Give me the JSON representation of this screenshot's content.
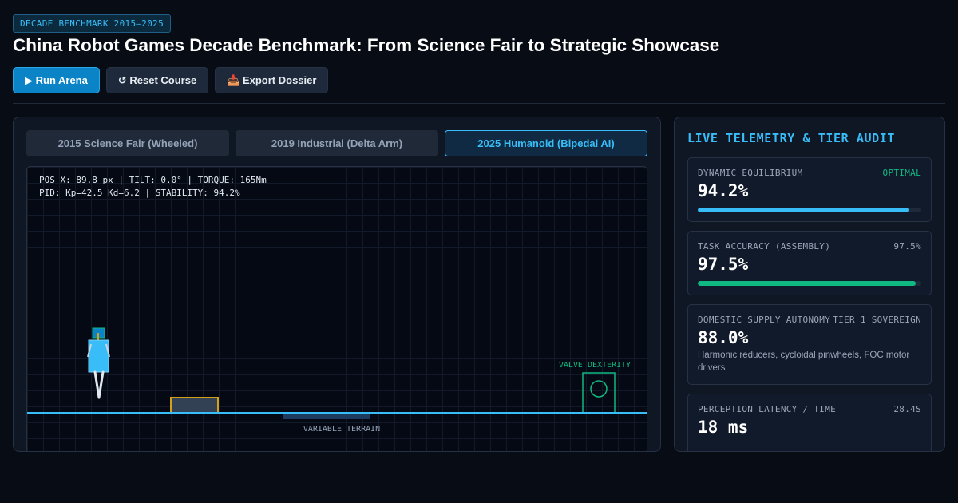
{
  "header": {
    "badge": "DECADE BENCHMARK 2015–2025",
    "title": "China Robot Games Decade Benchmark: From Science Fair to Strategic Showcase"
  },
  "toolbar": {
    "run_label": "▶ Run Arena",
    "reset_label": "↺ Reset Course",
    "export_label": "📥 Export Dossier"
  },
  "tabs": [
    {
      "label": "2015 Science Fair (Wheeled)",
      "active": false
    },
    {
      "label": "2019 Industrial (Delta Arm)",
      "active": false
    },
    {
      "label": "2025 Humanoid (Bipedal AI)",
      "active": true
    }
  ],
  "arena": {
    "readout_line1": "POS X: 89.8 px | TILT: 0.0° | TORQUE: 165Nm",
    "readout_line2": "PID: Kp=42.5 Kd=6.2 | STABILITY: 94.2%",
    "valve_label": "VALVE DEXTERITY",
    "terrain_label": "VARIABLE TERRAIN"
  },
  "telemetry": {
    "title": "LIVE TELEMETRY & TIER AUDIT",
    "cards": [
      {
        "label": "DYNAMIC EQUILIBRIUM",
        "status": "OPTIMAL",
        "value": "94.2%",
        "progress": 94.2,
        "bar_color": "#38bdf8",
        "status_color": "#10b981"
      },
      {
        "label": "TASK ACCURACY (ASSEMBLY)",
        "status": "97.5%",
        "value": "97.5%",
        "progress": 97.5,
        "bar_color": "#10b981",
        "status_color": "#9aa6b8"
      },
      {
        "label": "DOMESTIC SUPPLY AUTONOMY",
        "status": "TIER 1 SOVEREIGN",
        "value": "88.0%",
        "note": "Harmonic reducers, cycloidal pinwheels, FOC motor drivers",
        "status_color": "#9aa6b8"
      },
      {
        "label": "PERCEPTION LATENCY / TIME",
        "status": "28.4S",
        "value": "18 ms",
        "status_color": "#9aa6b8"
      }
    ]
  },
  "colors": {
    "accent": "#38bdf8",
    "success": "#10b981",
    "obstacle": "#d4a017",
    "valve": "#10b981"
  }
}
